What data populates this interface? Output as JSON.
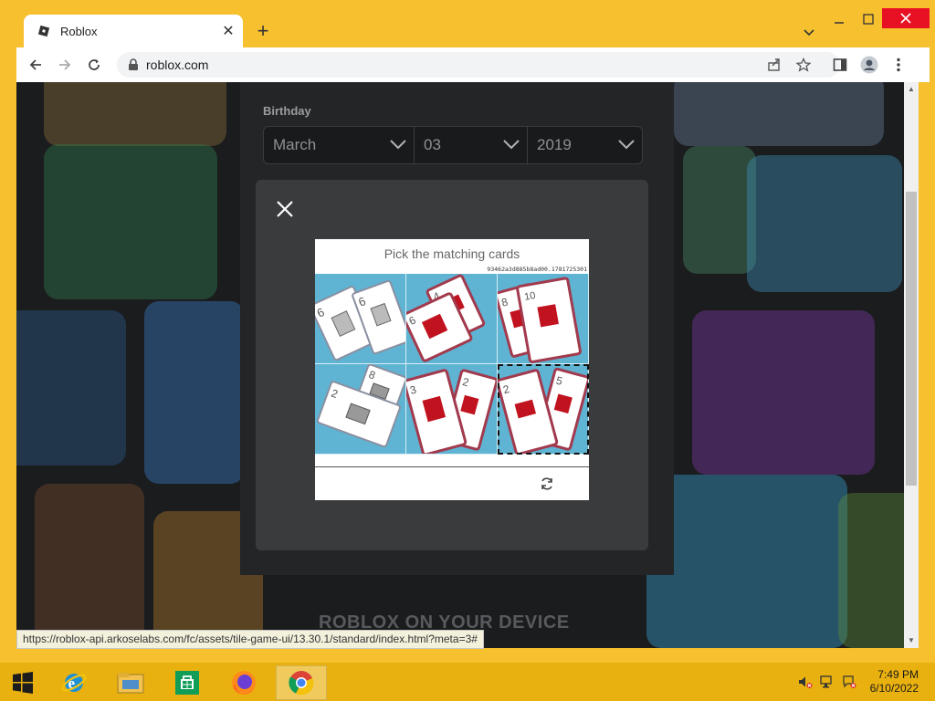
{
  "browser": {
    "tab": {
      "title": "Roblox",
      "close_glyph": "✕"
    },
    "new_tab_glyph": "+",
    "address": {
      "url": "roblox.com"
    },
    "status_url": "https://roblox-api.arkoselabs.com/fc/assets/tile-game-ui/13.30.1/standard/index.html?meta=3#",
    "accent": "#f6c02f"
  },
  "signup": {
    "birthday_label": "Birthday",
    "month": "March",
    "day": "03",
    "year": "2019",
    "footer_heading": "ROBLOX ON YOUR DEVICE"
  },
  "captcha": {
    "title": "Pick the matching cards",
    "session_id": "93462a3d885b8ad00.1781725301",
    "tiles": [
      {
        "cards": [
          "6 trash",
          "6 trash"
        ],
        "selected": false
      },
      {
        "cards": [
          "6 red box",
          "4 red box"
        ],
        "selected": false
      },
      {
        "cards": [
          "8 red box",
          "10 red box"
        ],
        "selected": false
      },
      {
        "cards": [
          "2 box",
          "8 envelope"
        ],
        "selected": false
      },
      {
        "cards": [
          "3 red bag",
          "2 red bag"
        ],
        "selected": false
      },
      {
        "cards": [
          "2 red envelope",
          "5 red bag"
        ],
        "selected": true
      }
    ]
  },
  "taskbar": {
    "items": [
      "start-icon",
      "internet-explorer-icon",
      "file-explorer-icon",
      "store-icon",
      "firefox-icon",
      "chrome-icon"
    ],
    "clock_time": "7:49 PM",
    "clock_date": "6/10/2022"
  }
}
